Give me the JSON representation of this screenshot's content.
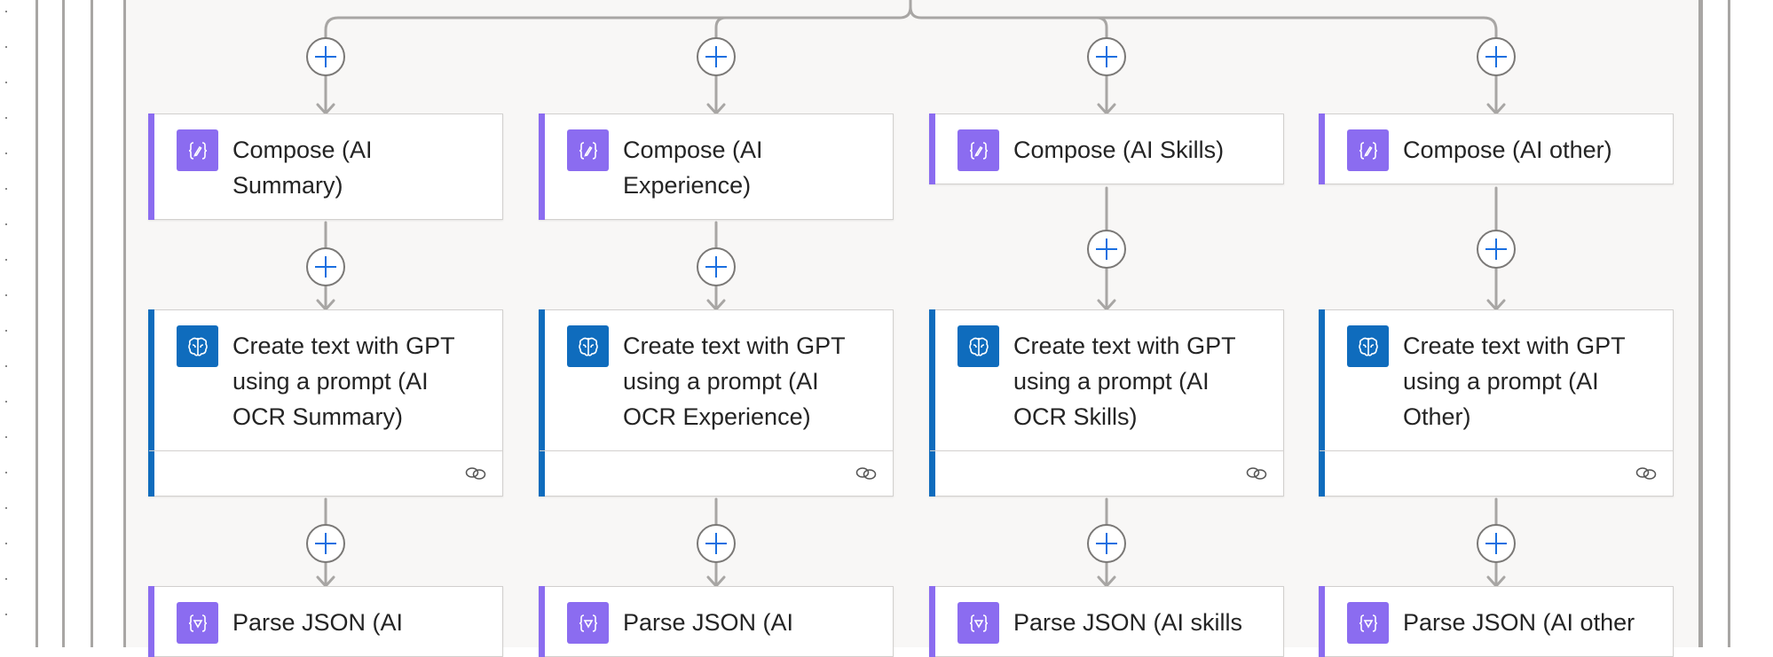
{
  "colors": {
    "compose_accent": "#8b6cf0",
    "gpt_accent": "#0f6cbd",
    "plus_color": "#1a6fe0",
    "connector": "#a8a6a4",
    "canvas_bg": "#f8f7f6"
  },
  "icons": {
    "compose": "compose-braces-icon",
    "gpt": "ai-brain-icon",
    "parse": "parse-json-icon",
    "footer": "link-chain-icon",
    "insert": "add-step-plus-icon"
  },
  "columns": [
    {
      "compose": "Compose (AI Summary)",
      "gpt": "Create text with GPT using a prompt (AI OCR Summary)",
      "parse": "Parse JSON (AI"
    },
    {
      "compose": "Compose (AI Experience)",
      "gpt": "Create text with GPT using a prompt (AI OCR Experience)",
      "parse": "Parse JSON (AI"
    },
    {
      "compose": "Compose (AI Skills)",
      "gpt": "Create text with GPT using a prompt (AI OCR Skills)",
      "parse": "Parse JSON (AI skills"
    },
    {
      "compose": "Compose (AI other)",
      "gpt": "Create text with GPT using a prompt (AI Other)",
      "parse": "Parse JSON (AI other"
    }
  ]
}
